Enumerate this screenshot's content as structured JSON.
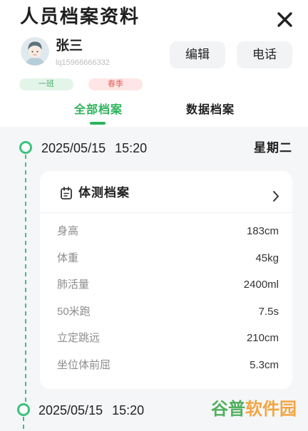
{
  "header": {
    "title": "人员档案资料",
    "close_icon": "close-icon"
  },
  "profile": {
    "avatar_icon": "avatar-boy-icon",
    "name": "张三",
    "username": "lq15966666332",
    "actions": {
      "edit_label": "编辑",
      "phone_label": "电话"
    },
    "tags": [
      {
        "label": "一班",
        "color": "#45b06a",
        "background": "#e3f5e9"
      },
      {
        "label": "春季",
        "color": "#e2685e",
        "background": "#fde6e5"
      }
    ]
  },
  "tabs": [
    {
      "label": "全部档案",
      "active": true
    },
    {
      "label": "数据档案",
      "active": false
    }
  ],
  "timeline": [
    {
      "date": "2025/05/15",
      "time": "15:20",
      "weekday": "星期二",
      "card": {
        "icon": "clipboard-icon",
        "title": "体测档案",
        "chevron_icon": "chevron-right-icon",
        "rows": [
          {
            "label": "身高",
            "value": "183cm"
          },
          {
            "label": "体重",
            "value": "45kg"
          },
          {
            "label": "肺活量",
            "value": "2400ml"
          },
          {
            "label": "50米跑",
            "value": "7.5s"
          },
          {
            "label": "立定跳远",
            "value": "210cm"
          },
          {
            "label": "坐位体前屈",
            "value": "5.3cm"
          }
        ]
      }
    },
    {
      "date": "2025/05/15",
      "time": "15:20"
    }
  ],
  "watermark": {
    "part1": "谷普",
    "part2": "软件园",
    "part1_color": "#3aa64a",
    "part2_color": "#f39a2b"
  },
  "colors": {
    "accent": "#2db35b",
    "timeline": "#3cc27c",
    "background": "#f5f6f8"
  }
}
